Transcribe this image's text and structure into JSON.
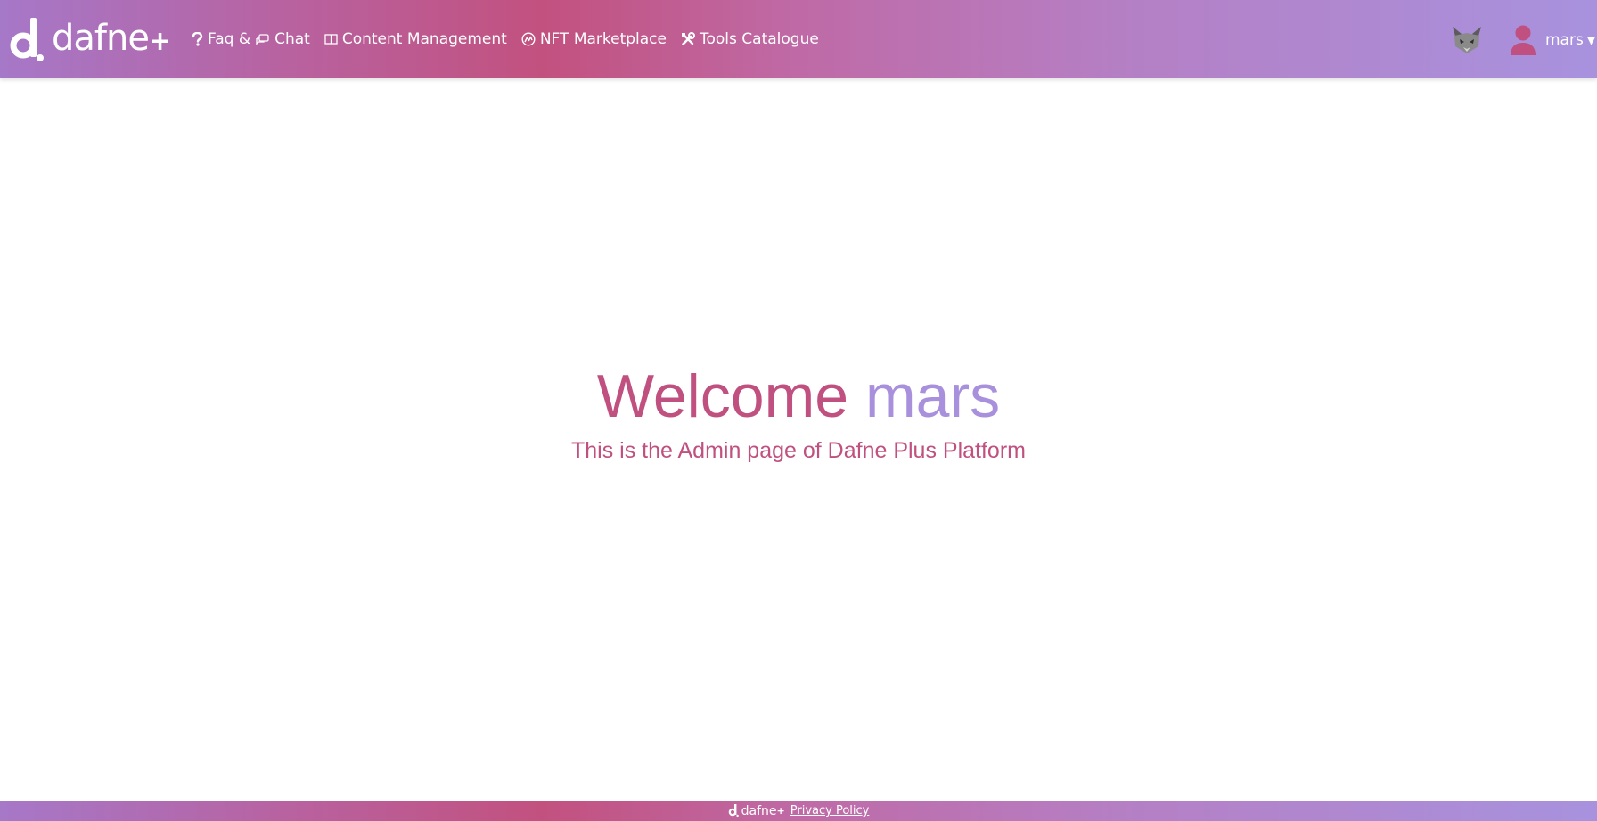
{
  "brand": {
    "logo_text": "dafne",
    "logo_plus": "+"
  },
  "nav": {
    "faq_label": "Faq &",
    "chat_label": "Chat",
    "content_label": "Content Management",
    "nft_label": "NFT Marketplace",
    "tools_label": "Tools Catalogue"
  },
  "user": {
    "name": "mars"
  },
  "main": {
    "welcome_word": "Welcome",
    "welcome_name": "mars",
    "subtitle": "This is the Admin page of Dafne Plus Platform"
  },
  "footer": {
    "logo_text": "dafne",
    "logo_plus": "+",
    "privacy_label": "Privacy Policy"
  },
  "colors": {
    "accent_pink": "#c0507f",
    "accent_lavender": "#a890dc"
  },
  "icons": [
    "question-icon",
    "chat-icon",
    "book-icon",
    "marketplace-icon",
    "tools-icon",
    "metamask-fox-icon",
    "user-icon",
    "caret-down-icon"
  ]
}
